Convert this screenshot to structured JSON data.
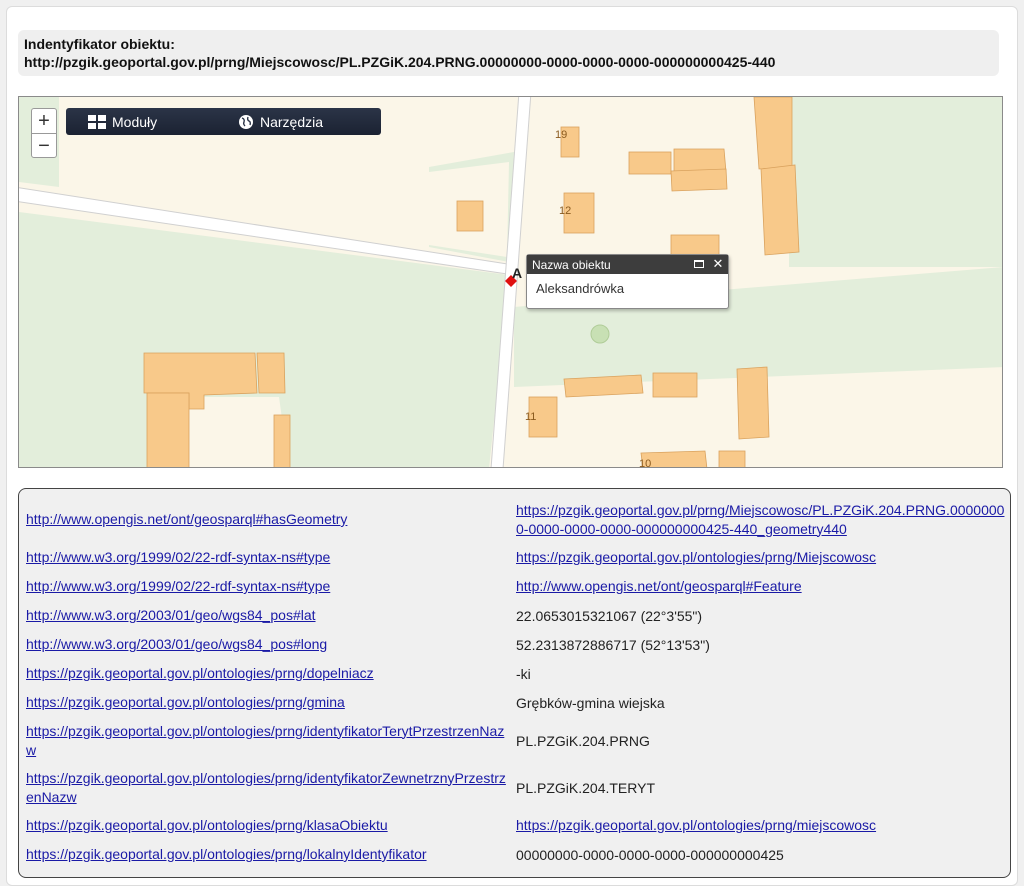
{
  "identifier": {
    "label": "Indentyfikator obiektu:",
    "uri": "http://pzgik.geoportal.gov.pl/prng/Miejscowosc/PL.PZGiK.204.PRNG.00000000-0000-0000-0000-000000000425-440"
  },
  "map": {
    "zoom_in": "+",
    "zoom_out": "−",
    "toolbar": {
      "modules": "Moduły",
      "tools": "Narzędzia"
    },
    "marker_label": "A",
    "house_numbers": [
      "19",
      "12",
      "11",
      "10"
    ],
    "popup": {
      "title": "Nazwa obiektu",
      "content": "Aleksandrówka",
      "maximize_icon": "maximize-icon",
      "close_icon": "close-icon",
      "close_glyph": "✕"
    },
    "colors": {
      "building": "#f8c98a",
      "green": "#e3eedb",
      "road": "#ffffff",
      "marker": "#e01010",
      "popup_header": "#3d3d3d"
    }
  },
  "properties": [
    {
      "key": "http://www.opengis.net/ont/geosparql#hasGeometry",
      "value": "https://pzgik.geoportal.gov.pl/prng/Miejscowosc/PL.PZGiK.204.PRNG.00000000-0000-0000-0000-000000000425-440_geometry440",
      "value_is_link": true
    },
    {
      "key": "http://www.w3.org/1999/02/22-rdf-syntax-ns#type",
      "value": "https://pzgik.geoportal.gov.pl/ontologies/prng/Miejscowosc",
      "value_is_link": true
    },
    {
      "key": "http://www.w3.org/1999/02/22-rdf-syntax-ns#type",
      "value": "http://www.opengis.net/ont/geosparql#Feature",
      "value_is_link": true
    },
    {
      "key": "http://www.w3.org/2003/01/geo/wgs84_pos#lat",
      "value": "22.0653015321067 (22°3'55\")",
      "value_is_link": false
    },
    {
      "key": "http://www.w3.org/2003/01/geo/wgs84_pos#long",
      "value": "52.2313872886717 (52°13'53\")",
      "value_is_link": false
    },
    {
      "key": "https://pzgik.geoportal.gov.pl/ontologies/prng/dopelniacz",
      "value": "-ki",
      "value_is_link": false
    },
    {
      "key": "https://pzgik.geoportal.gov.pl/ontologies/prng/gmina",
      "value": "Grębków-gmina wiejska",
      "value_is_link": false
    },
    {
      "key": "https://pzgik.geoportal.gov.pl/ontologies/prng/identyfikatorTerytPrzestrzenNazw",
      "value": "PL.PZGiK.204.PRNG",
      "value_is_link": false
    },
    {
      "key": "https://pzgik.geoportal.gov.pl/ontologies/prng/identyfikatorZewnetrznyPrzestrzenNazw",
      "value": "PL.PZGiK.204.TERYT",
      "value_is_link": false
    },
    {
      "key": "https://pzgik.geoportal.gov.pl/ontologies/prng/klasaObiektu",
      "value": "https://pzgik.geoportal.gov.pl/ontologies/prng/miejscowosc",
      "value_is_link": true
    },
    {
      "key": "https://pzgik.geoportal.gov.pl/ontologies/prng/lokalnyIdentyfikator",
      "value": "00000000-0000-0000-0000-000000000425",
      "value_is_link": false
    }
  ]
}
